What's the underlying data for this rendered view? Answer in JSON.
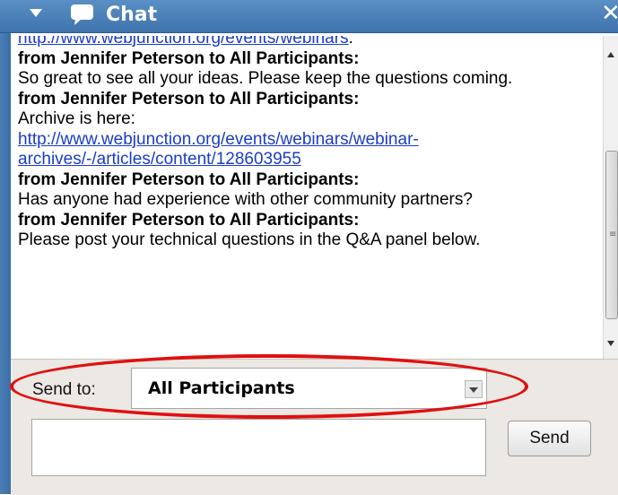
{
  "header": {
    "title": "Chat",
    "icons": {
      "collapse": "triangle-down-icon",
      "chat": "chat-bubble-icon",
      "close": "close-icon"
    }
  },
  "messages": [
    {
      "type": "link",
      "text": "http://www.webjunction.org/events/webinars",
      "suffix": "."
    },
    {
      "type": "sender",
      "text": "from Jennifer Peterson to All Participants:"
    },
    {
      "type": "text",
      "text": "So great to see all your ideas. Please keep the questions coming."
    },
    {
      "type": "sender",
      "text": "from Jennifer Peterson to All Participants:"
    },
    {
      "type": "text",
      "text": "Archive is here:"
    },
    {
      "type": "link",
      "text": "http://www.webjunction.org/events/webinars/webinar-"
    },
    {
      "type": "link",
      "text": "archives/-/articles/content/128603955"
    },
    {
      "type": "sender",
      "text": "from Jennifer Peterson to All Participants:"
    },
    {
      "type": "text",
      "text": "Has anyone had experience with other community partners?"
    },
    {
      "type": "sender",
      "text": "from Jennifer Peterson to All Participants:"
    },
    {
      "type": "text",
      "text": "Please post your technical questions in the Q&A panel below."
    }
  ],
  "compose": {
    "send_to_label": "Send to:",
    "recipient": "All Participants",
    "message_value": "",
    "send_label": "Send"
  },
  "colors": {
    "header": "#4a7eb6",
    "link": "#1a3cc8",
    "panel": "#ece9e4",
    "highlight": "#e01010"
  }
}
